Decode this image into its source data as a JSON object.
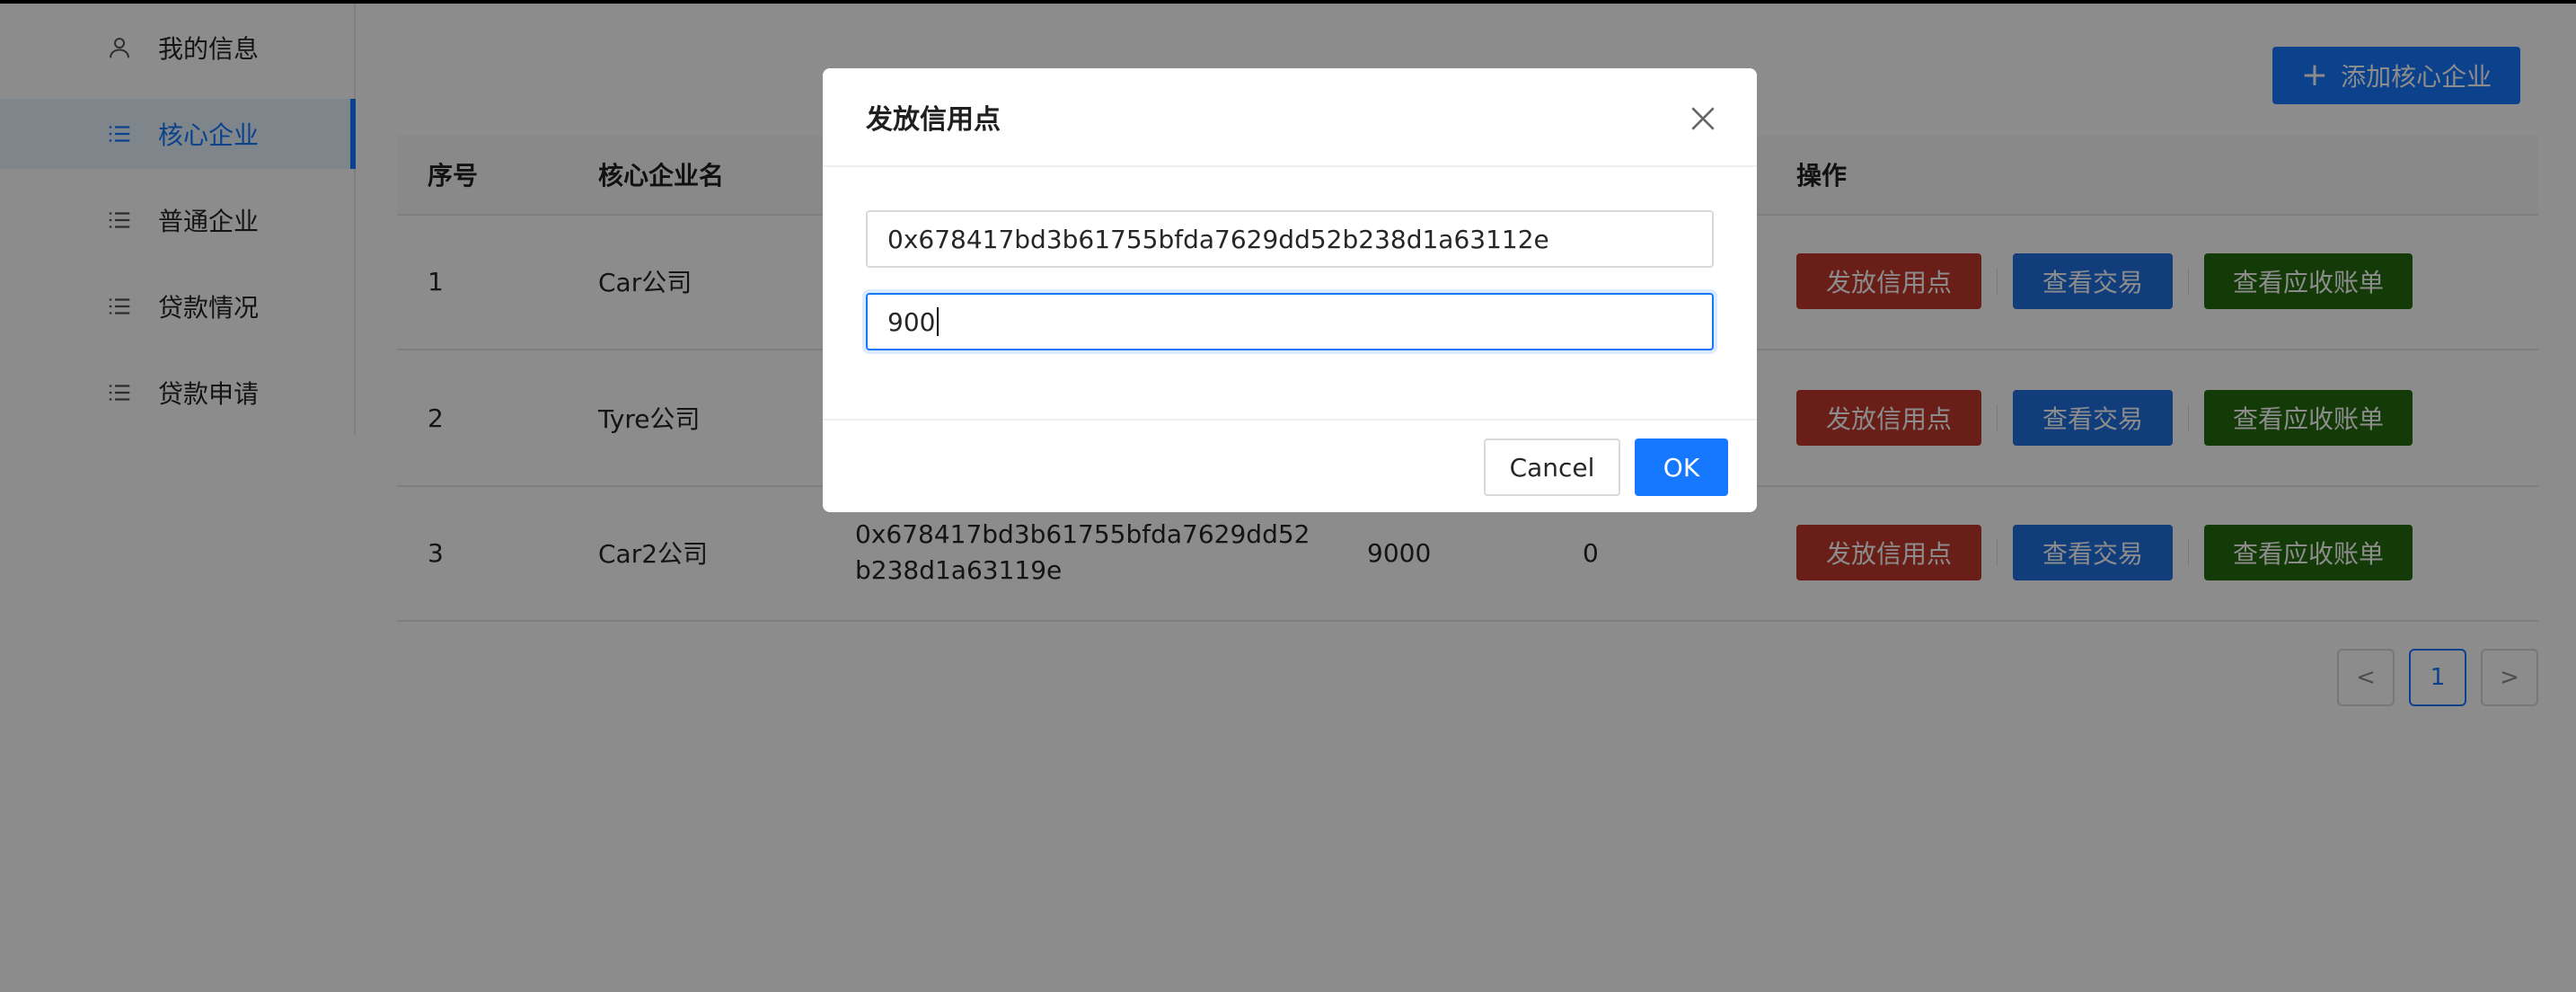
{
  "sidebar": {
    "items": [
      {
        "label": "我的信息",
        "icon": "user-icon",
        "active": false
      },
      {
        "label": "核心企业",
        "icon": "list-icon",
        "active": true
      },
      {
        "label": "普通企业",
        "icon": "list-icon",
        "active": false
      },
      {
        "label": "贷款情况",
        "icon": "list-icon",
        "active": false
      },
      {
        "label": "贷款申请",
        "icon": "list-icon",
        "active": false
      }
    ]
  },
  "header": {
    "add_button_label": "添加核心企业"
  },
  "table": {
    "columns": [
      "序号",
      "核心企业名",
      "",
      "",
      "",
      "操作"
    ],
    "rows": [
      {
        "index": "1",
        "name": "Car公司",
        "address": "",
        "col4": "",
        "col5": ""
      },
      {
        "index": "2",
        "name": "Tyre公司",
        "address": "",
        "col4": "",
        "col5": ""
      },
      {
        "index": "3",
        "name": "Car2公司",
        "address": "0x678417bd3b61755bfda7629dd52b238d1a63119e",
        "col4": "9000",
        "col5": "0"
      }
    ],
    "actions": {
      "issue_credit": "发放信用点",
      "view_transactions": "查看交易",
      "view_receivables": "查看应收账单"
    }
  },
  "pagination": {
    "prev": "<",
    "current": "1",
    "next": ">"
  },
  "modal": {
    "title": "发放信用点",
    "address_value": "0x678417bd3b61755bfda7629dd52b238d1a63112e",
    "amount_value": "900",
    "cancel_label": "Cancel",
    "ok_label": "OK"
  },
  "colors": {
    "primary": "#1677ff",
    "danger": "#c0392b",
    "info": "#1f6fe0",
    "success": "#236b0d"
  }
}
